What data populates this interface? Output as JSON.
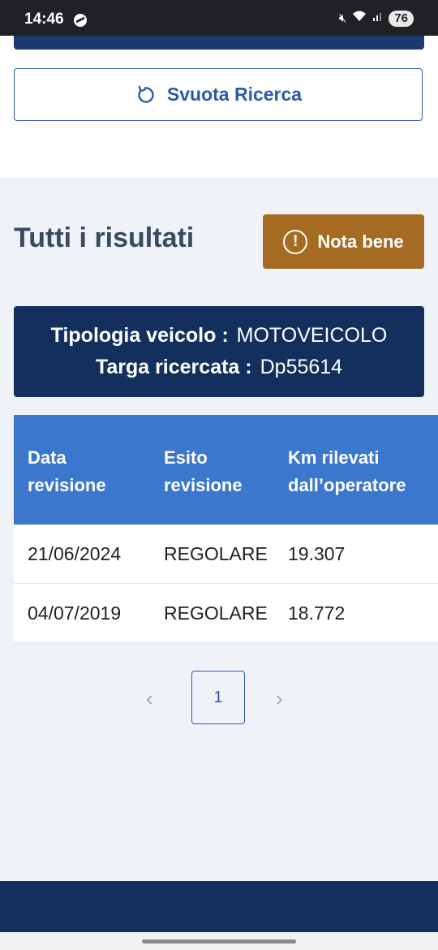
{
  "status_bar": {
    "time": "14:46",
    "battery": "76",
    "icons": [
      "messenger-icon",
      "mute-icon",
      "wifi-icon",
      "signal-icon"
    ]
  },
  "search": {
    "reset_label": "Svuota Ricerca"
  },
  "results": {
    "title": "Tutti i risultati",
    "note_button_label": "Nota bene",
    "vehicle_type_label": "Tipologia veicolo :",
    "vehicle_type_value": "MOTOVEICOLO",
    "plate_label": "Targa ricercata :",
    "plate_value": "Dp55614"
  },
  "table": {
    "headers": [
      [
        "Data",
        "revisione"
      ],
      [
        "Esito",
        "revisione"
      ],
      [
        "Km rilevati",
        "dall’operatore"
      ]
    ],
    "rows": [
      [
        "21/06/2024",
        "REGOLARE",
        "19.307"
      ],
      [
        "04/07/2019",
        "REGOLARE",
        "18.772"
      ]
    ]
  },
  "pagination": {
    "current_page": "1",
    "prev_symbol": "‹",
    "next_symbol": "›"
  },
  "colors": {
    "primary_dark": "#13305d",
    "primary": "#2b5aa8",
    "table_header": "#3b77cc",
    "note_button": "#a56b22",
    "background_light": "#eff3f8"
  }
}
